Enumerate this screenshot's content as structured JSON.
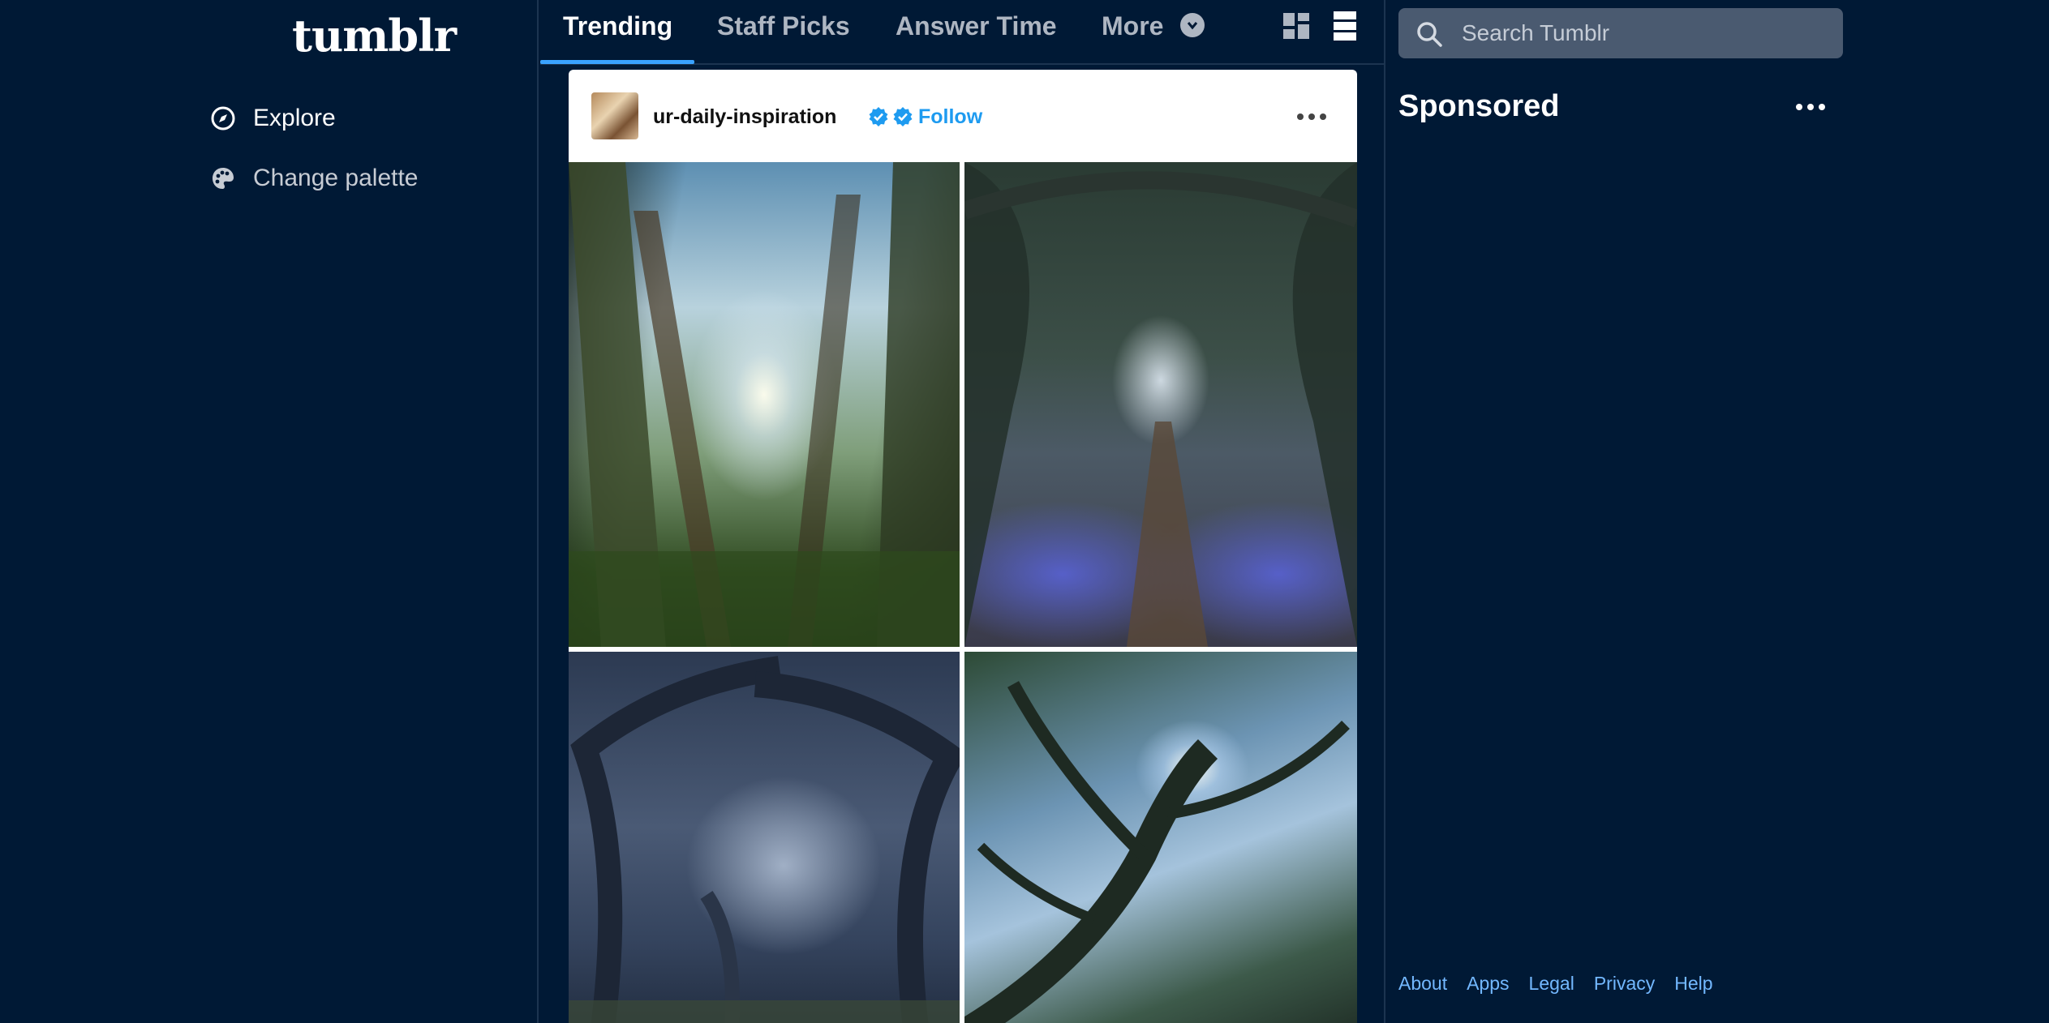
{
  "brand": {
    "logo": "tumblr"
  },
  "sidebar": {
    "items": [
      {
        "label": "Explore",
        "icon": "compass-icon"
      },
      {
        "label": "Change palette",
        "icon": "palette-icon"
      }
    ]
  },
  "tabs": [
    {
      "label": "Trending",
      "active": true
    },
    {
      "label": "Staff Picks",
      "active": false
    },
    {
      "label": "Answer Time",
      "active": false
    },
    {
      "label": "More",
      "active": false
    }
  ],
  "view_toggles": [
    "grid-view-icon",
    "list-view-icon"
  ],
  "post": {
    "username": "ur-daily-inspiration",
    "verified_badges": 2,
    "follow_label": "Follow",
    "images": [
      "sunlit redwood forest canopy",
      "bluebell forest path",
      "misty twisted oak forest",
      "sunlight through oak branches"
    ]
  },
  "search": {
    "placeholder": "Search Tumblr"
  },
  "right": {
    "sponsored_label": "Sponsored"
  },
  "footer": {
    "links": [
      "About",
      "Apps",
      "Legal",
      "Privacy",
      "Help"
    ]
  },
  "colors": {
    "background": "#001935",
    "accent": "#1e9bf0",
    "tab_underline": "#3aa3ff",
    "footer_link": "#73b8ff"
  }
}
